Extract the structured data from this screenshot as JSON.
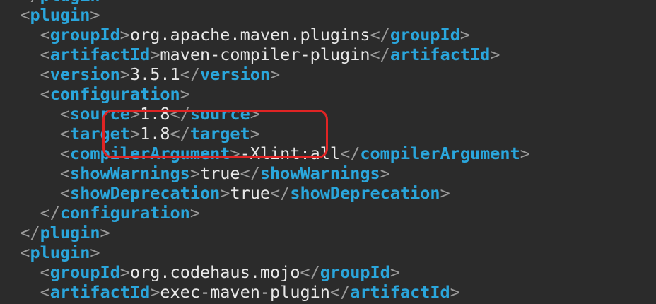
{
  "annotation": {
    "color": "#e02424"
  },
  "lines": [
    {
      "indent": "  ",
      "close": true,
      "tag": "plugin",
      "text": ""
    },
    {
      "indent": "  ",
      "close": false,
      "open_only": true,
      "tag": "plugin"
    },
    {
      "indent": "    ",
      "tag": "groupId",
      "text": "org.apache.maven.plugins"
    },
    {
      "indent": "    ",
      "tag": "artifactId",
      "text": "maven-compiler-plugin"
    },
    {
      "indent": "    ",
      "tag": "version",
      "text": "3.5.1"
    },
    {
      "indent": "    ",
      "open_only": true,
      "tag": "configuration"
    },
    {
      "indent": "      ",
      "tag": "source",
      "text": "1.8"
    },
    {
      "indent": "      ",
      "tag": "target",
      "text": "1.8"
    },
    {
      "indent": "      ",
      "tag": "compilerArgument",
      "text": "-Xlint:all"
    },
    {
      "indent": "      ",
      "tag": "showWarnings",
      "text": "true"
    },
    {
      "indent": "      ",
      "tag": "showDeprecation",
      "text": "true"
    },
    {
      "indent": "    ",
      "close": true,
      "tag": "configuration"
    },
    {
      "indent": "  ",
      "close": true,
      "tag": "plugin"
    },
    {
      "indent": "  ",
      "open_only": true,
      "tag": "plugin"
    },
    {
      "indent": "    ",
      "tag": "groupId",
      "text": "org.codehaus.mojo"
    },
    {
      "indent": "    ",
      "tag": "artifactId",
      "text": "exec-maven-plugin"
    }
  ]
}
